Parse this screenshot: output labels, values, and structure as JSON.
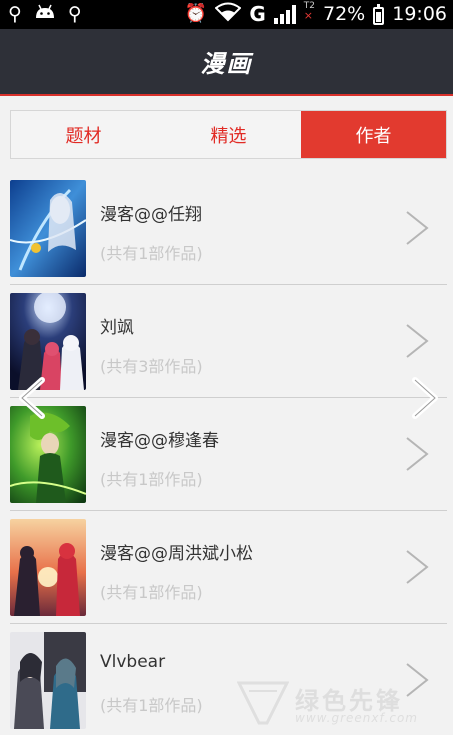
{
  "status_bar": {
    "network": "G",
    "sim2_label": "T2",
    "sim2_mark": "×",
    "battery_percent": "72%",
    "time": "19:06"
  },
  "header": {
    "title": "漫画"
  },
  "tabs": [
    {
      "label": "题材",
      "active": false
    },
    {
      "label": "精选",
      "active": false
    },
    {
      "label": "作者",
      "active": true
    }
  ],
  "authors": [
    {
      "name": "漫客@@任翔",
      "works": "(共有1部作品)"
    },
    {
      "name": "刘飒",
      "works": "(共有3部作品)"
    },
    {
      "name": "漫客@@穆逢春",
      "works": "(共有1部作品)"
    },
    {
      "name": "漫客@@周洪斌小松",
      "works": "(共有1部作品)"
    },
    {
      "name": "Vlvbear",
      "works": "(共有1部作品)"
    }
  ],
  "watermark": {
    "text": "绿色先锋",
    "url": "www.greenxf.com"
  },
  "colors": {
    "accent": "#e23a2f",
    "header_bg": "#2e3038",
    "page_bg": "#f2f2f2"
  },
  "icons": [
    "usb-icon",
    "android-icon",
    "alarm-icon",
    "wifi-icon",
    "signal-icon",
    "battery-icon",
    "chevron-right-icon",
    "arrow-left-icon",
    "arrow-right-icon"
  ]
}
